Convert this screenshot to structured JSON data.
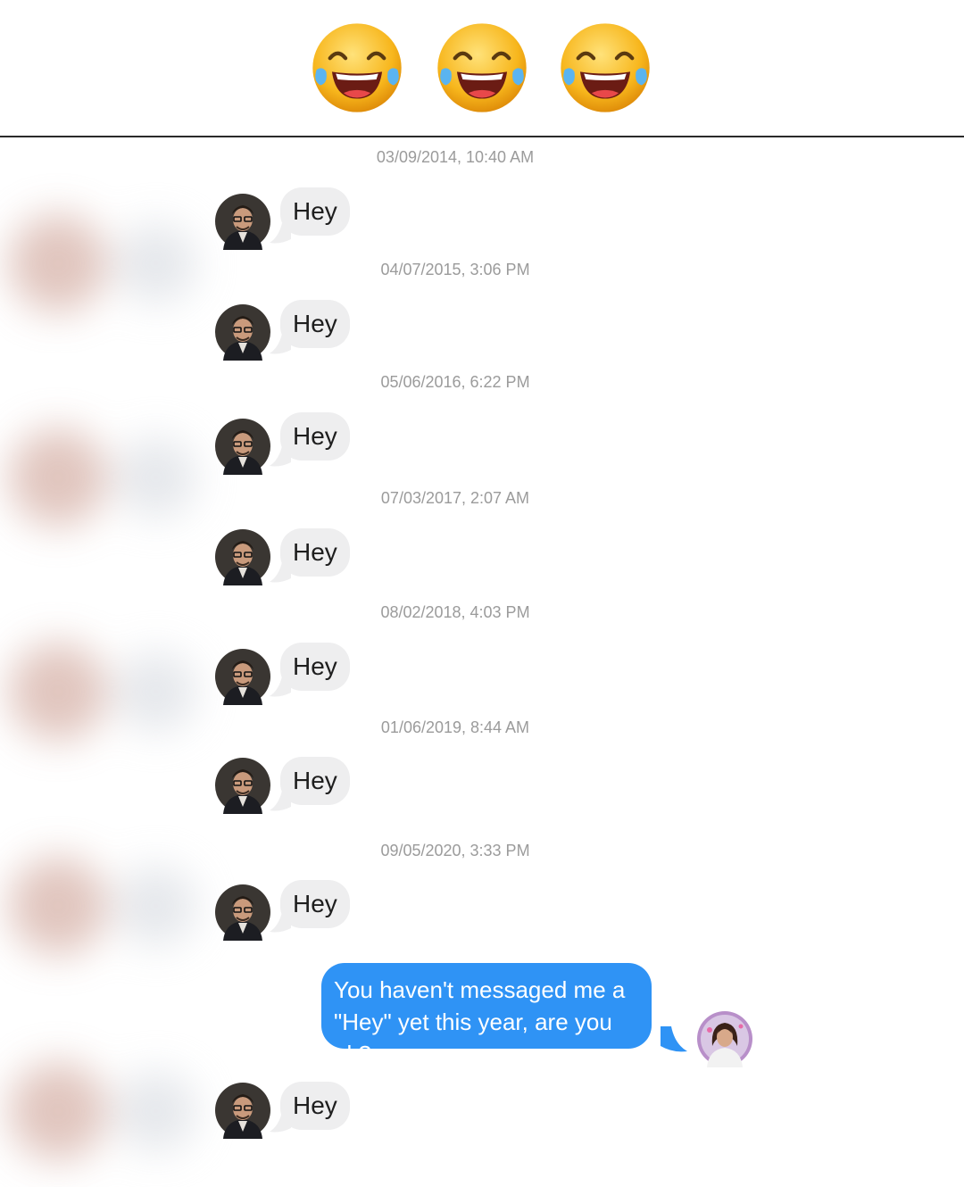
{
  "header": {
    "emojis": [
      "face-with-tears-of-joy-emoji",
      "face-with-tears-of-joy-emoji",
      "face-with-tears-of-joy-emoji"
    ]
  },
  "conversation": {
    "messages": [
      {
        "timestamp": "03/09/2014, 10:40 AM",
        "text": "Hey"
      },
      {
        "timestamp": "04/07/2015, 3:06 PM",
        "text": "Hey"
      },
      {
        "timestamp": "05/06/2016, 6:22 PM",
        "text": "Hey"
      },
      {
        "timestamp": "07/03/2017, 2:07 AM",
        "text": "Hey"
      },
      {
        "timestamp": "08/02/2018, 4:03 PM",
        "text": "Hey"
      },
      {
        "timestamp": "01/06/2019, 8:44 AM",
        "text": "Hey"
      },
      {
        "timestamp": "09/05/2020, 3:33 PM",
        "text": "Hey"
      }
    ],
    "reply": {
      "line1": "You haven't messaged me a",
      "line2": "\"Hey\" yet this year, are you ok?"
    },
    "final_message": {
      "text": "Hey"
    }
  },
  "colors": {
    "incoming_bubble": "#eeeeef",
    "outgoing_bubble": "#2f93f5",
    "timestamp": "#9b9b9b"
  }
}
